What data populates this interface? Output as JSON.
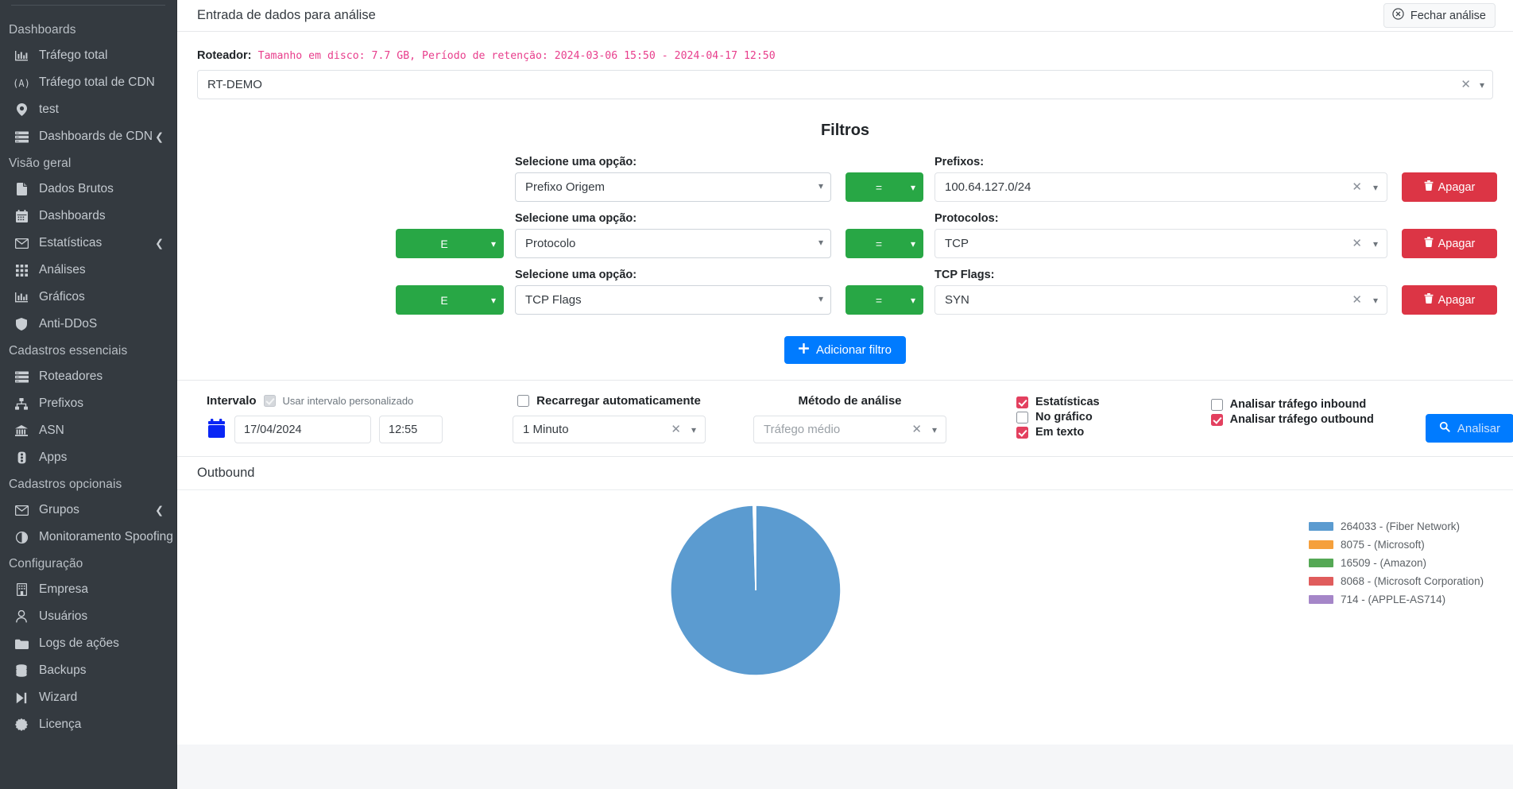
{
  "sidebar": {
    "groups": [
      {
        "title": "Dashboards",
        "items": [
          {
            "label": "Tráfego total",
            "icon": "chart-bar-icon",
            "chevron": false
          },
          {
            "label": "Tráfego total de CDN",
            "icon": "broadcast-icon",
            "chevron": false
          },
          {
            "label": "test",
            "icon": "map-pin-icon",
            "chevron": false
          },
          {
            "label": "Dashboards de CDN",
            "icon": "server-icon",
            "chevron": true
          }
        ]
      },
      {
        "title": "Visão geral",
        "items": [
          {
            "label": "Dados Brutos",
            "icon": "document-icon",
            "chevron": false
          },
          {
            "label": "Dashboards",
            "icon": "calendar-icon",
            "chevron": false
          },
          {
            "label": "Estatísticas",
            "icon": "envelope-icon",
            "chevron": true
          },
          {
            "label": "Análises",
            "icon": "grid-icon",
            "chevron": false
          },
          {
            "label": "Gráficos",
            "icon": "chart-bar-icon",
            "chevron": false
          },
          {
            "label": "Anti-DDoS",
            "icon": "shield-icon",
            "chevron": false
          }
        ]
      },
      {
        "title": "Cadastros essenciais",
        "items": [
          {
            "label": "Roteadores",
            "icon": "server-icon",
            "chevron": false
          },
          {
            "label": "Prefixos",
            "icon": "sitemap-icon",
            "chevron": false
          },
          {
            "label": "ASN",
            "icon": "bank-icon",
            "chevron": false
          },
          {
            "label": "Apps",
            "icon": "traffic-light-icon",
            "chevron": false
          }
        ]
      },
      {
        "title": "Cadastros opcionais",
        "items": [
          {
            "label": "Grupos",
            "icon": "envelope-icon",
            "chevron": true
          },
          {
            "label": "Monitoramento Spoofing",
            "icon": "contrast-circle-icon",
            "chevron": false
          }
        ]
      },
      {
        "title": "Configuração",
        "items": [
          {
            "label": "Empresa",
            "icon": "building-icon",
            "chevron": false
          },
          {
            "label": "Usuários",
            "icon": "user-icon",
            "chevron": false
          },
          {
            "label": "Logs de ações",
            "icon": "folder-open-icon",
            "chevron": false
          },
          {
            "label": "Backups",
            "icon": "database-icon",
            "chevron": false
          },
          {
            "label": "Wizard",
            "icon": "step-forward-icon",
            "chevron": false
          },
          {
            "label": "Licença",
            "icon": "certificate-icon",
            "chevron": false
          }
        ]
      }
    ]
  },
  "topbar": {
    "title": "Entrada de dados para análise",
    "close_label": "Fechar análise"
  },
  "router_panel": {
    "label": "Roteador:",
    "info": "Tamanho em disco: 7.7 GB, Período de retenção: 2024-03-06 15:50 - 2024-04-17 12:50",
    "selected": "RT-DEMO"
  },
  "filters": {
    "title": "Filtros",
    "option_label": "Selecione uma opção:",
    "rows": [
      {
        "logic": "",
        "field": "Prefixo Origem",
        "operator": "=",
        "value_label": "Prefixos:",
        "value": "100.64.127.0/24",
        "delete_label": "Apagar"
      },
      {
        "logic": "E",
        "field": "Protocolo",
        "operator": "=",
        "value_label": "Protocolos:",
        "value": "TCP",
        "delete_label": "Apagar"
      },
      {
        "logic": "E",
        "field": "TCP Flags",
        "operator": "=",
        "value_label": "TCP Flags:",
        "value": "SYN",
        "delete_label": "Apagar"
      }
    ],
    "add_label": "Adicionar filtro"
  },
  "interval": {
    "title": "Intervalo",
    "custom_label": "Usar intervalo personalizado",
    "custom_checked": true,
    "date": "17/04/2024",
    "time": "12:55",
    "autoreload_label": "Recarregar automaticamente",
    "autoreload_checked": false,
    "autoreload_value": "1 Minuto",
    "method_title": "Método de análise",
    "method_placeholder": "Tráfego médio",
    "stats": [
      {
        "label": "Estatísticas",
        "checked": true
      },
      {
        "label": "No gráfico",
        "checked": false
      },
      {
        "label": "Em texto",
        "checked": true
      }
    ],
    "direction": [
      {
        "label": "Analisar tráfego inbound",
        "checked": false
      },
      {
        "label": "Analisar tráfego outbound",
        "checked": true
      }
    ],
    "analyze_label": "Analisar"
  },
  "chart_panel": {
    "title": "Outbound"
  },
  "chart_data": {
    "type": "pie",
    "title": "Outbound",
    "legend_position": "right",
    "labels": [
      "264033 - (Fiber Network)",
      "8075 - (Microsoft)",
      "16509 - (Amazon)",
      "8068 - (Microsoft Corporation)",
      "714 - (APPLE-AS714)"
    ],
    "values": [
      99.5,
      0.2,
      0.12,
      0.1,
      0.08
    ],
    "colors": [
      "#5b9bd0",
      "#f5a03c",
      "#55a855",
      "#e05c5c",
      "#a586c8"
    ]
  }
}
